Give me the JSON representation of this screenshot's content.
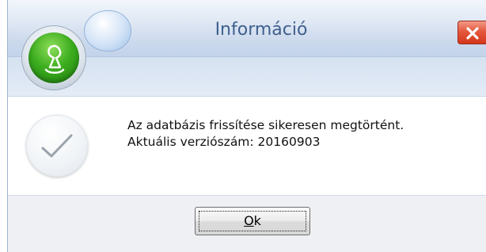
{
  "window": {
    "title": "Információ"
  },
  "titlebar": {
    "app_logo_icon": "green-orb-logo-icon",
    "quick_button_icon": "rounded-blob-button",
    "close_icon": "close-x-icon",
    "close_color": "#e5583e"
  },
  "message": {
    "icon": "checkmark-icon",
    "line1": "Az adatbázis frissítése sikeresen megtörtént.",
    "line2": "Aktuális verziószám: 20160903"
  },
  "buttons": {
    "ok_mnemonic": "O",
    "ok_rest": "k"
  },
  "colors": {
    "title_text": "#3f5f8d",
    "titlebar_bg": "#dfe8f4",
    "footer_bg": "#eef0f3"
  }
}
